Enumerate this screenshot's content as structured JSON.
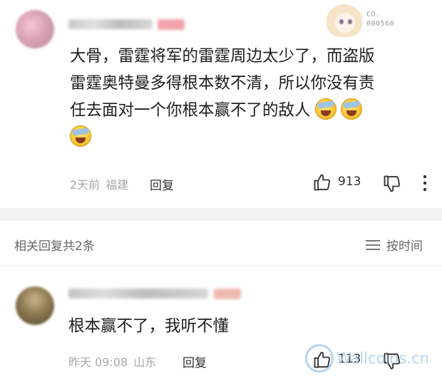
{
  "comment": {
    "text_line1": "大骨，雷霆将军的雷霆周边太少了，而盗版",
    "text_line2": "雷霆奥特曼多得根本数不清，所以你没有责",
    "text_line3": "任去面对一个你根本赢不了的敌人",
    "time": "2天前",
    "location": "福建",
    "reply_label": "回复",
    "like_count": "913",
    "sticker_code_line1": "CO.",
    "sticker_code_line2": "000560"
  },
  "related": {
    "label": "相关回复共2条",
    "sort_label": "按时间"
  },
  "reply": {
    "text": "根本赢不了，我听不懂",
    "time": "昨天 09:08",
    "location": "山东",
    "reply_label": "回复",
    "like_count": "113"
  },
  "watermark": {
    "text": "Wallcoins.cn"
  },
  "colors": {
    "divider": "#f2f2f2",
    "meta_text": "#a8a8a8",
    "body_text": "#1e1e1e",
    "watermark": "#9ec8e6"
  }
}
